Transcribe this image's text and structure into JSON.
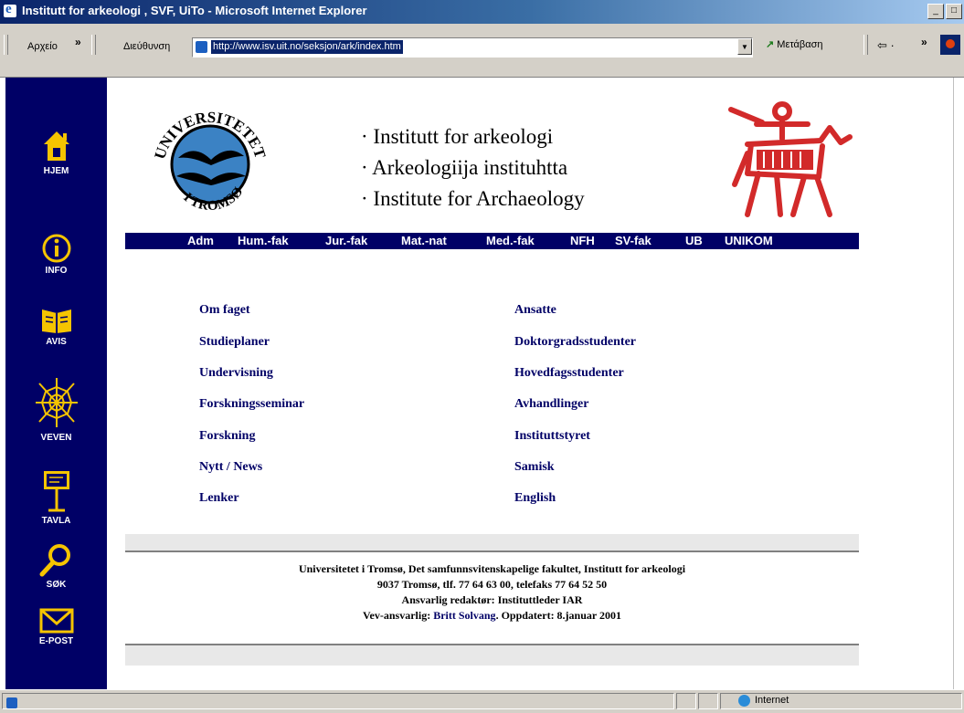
{
  "window": {
    "title": "Institutt for arkeologi , SVF, UiTo - Microsoft Internet Explorer",
    "buttons": [
      "_",
      "□"
    ]
  },
  "toolbar": {
    "archive_label": "Αρχείο",
    "chevron": "»",
    "address_label": "Διεύθυνση",
    "url": "http://www.isv.uit.no/seksjon/ark/index.htm",
    "go_label": "Μετάβαση",
    "nav_glyph": "⇦ ·",
    "chevron2": "»"
  },
  "sidebar": {
    "items": [
      {
        "label": "HJEM",
        "icon": "house-icon"
      },
      {
        "label": "INFO",
        "icon": "info-icon"
      },
      {
        "label": "AVIS",
        "icon": "newspaper-icon"
      },
      {
        "label": "VEVEN",
        "icon": "web-icon"
      },
      {
        "label": "TAVLA",
        "icon": "board-icon"
      },
      {
        "label": "SØK",
        "icon": "magnifier-icon"
      },
      {
        "label": "E-POST",
        "icon": "envelope-icon"
      }
    ]
  },
  "header": {
    "logo_top": "UNIVERSITETET",
    "logo_bottom": "I TROMSØ",
    "lines": [
      "Institutt for arkeologi",
      "Arkeologiija instituhtta",
      "Institute for Archaeology"
    ]
  },
  "faculty_bar": [
    "Adm",
    "Hum.-fak",
    "Jur.-fak",
    "Mat.-nat",
    "Med.-fak",
    "NFH",
    "SV-fak",
    "UB",
    "UNIKOM"
  ],
  "links": {
    "left": [
      "Om faget",
      "Studieplaner",
      "Undervisning",
      "Forskningsseminar",
      "Forskning",
      "Nytt / News",
      "Lenker"
    ],
    "right": [
      "Ansatte",
      "Doktorgradsstudenter",
      "Hovedfagsstudenter",
      "Avhandlinger",
      "Instituttstyret",
      "Samisk",
      "English"
    ]
  },
  "footer": {
    "line1": "Universitetet i Tromsø, Det samfunnsvitenskapelige fakultet, Institutt for arkeologi",
    "line2": "9037 Tromsø, tlf. 77 64 63 00, telefaks 77 64 52 50",
    "line3": "Ansvarlig redaktør: Instituttleder IAR",
    "line4_prefix": "Vev-ansvarlig:",
    "line4_link": "Britt Solvang",
    "line4_suffix": ". Oppdatert: 8.januar 2001"
  },
  "statusbar": {
    "zone": "Internet"
  },
  "colors": {
    "navy": "#000066",
    "logo_blue": "#3b82c4",
    "rock_art_red": "#d22a2a",
    "titlebar": "#0a246a"
  }
}
